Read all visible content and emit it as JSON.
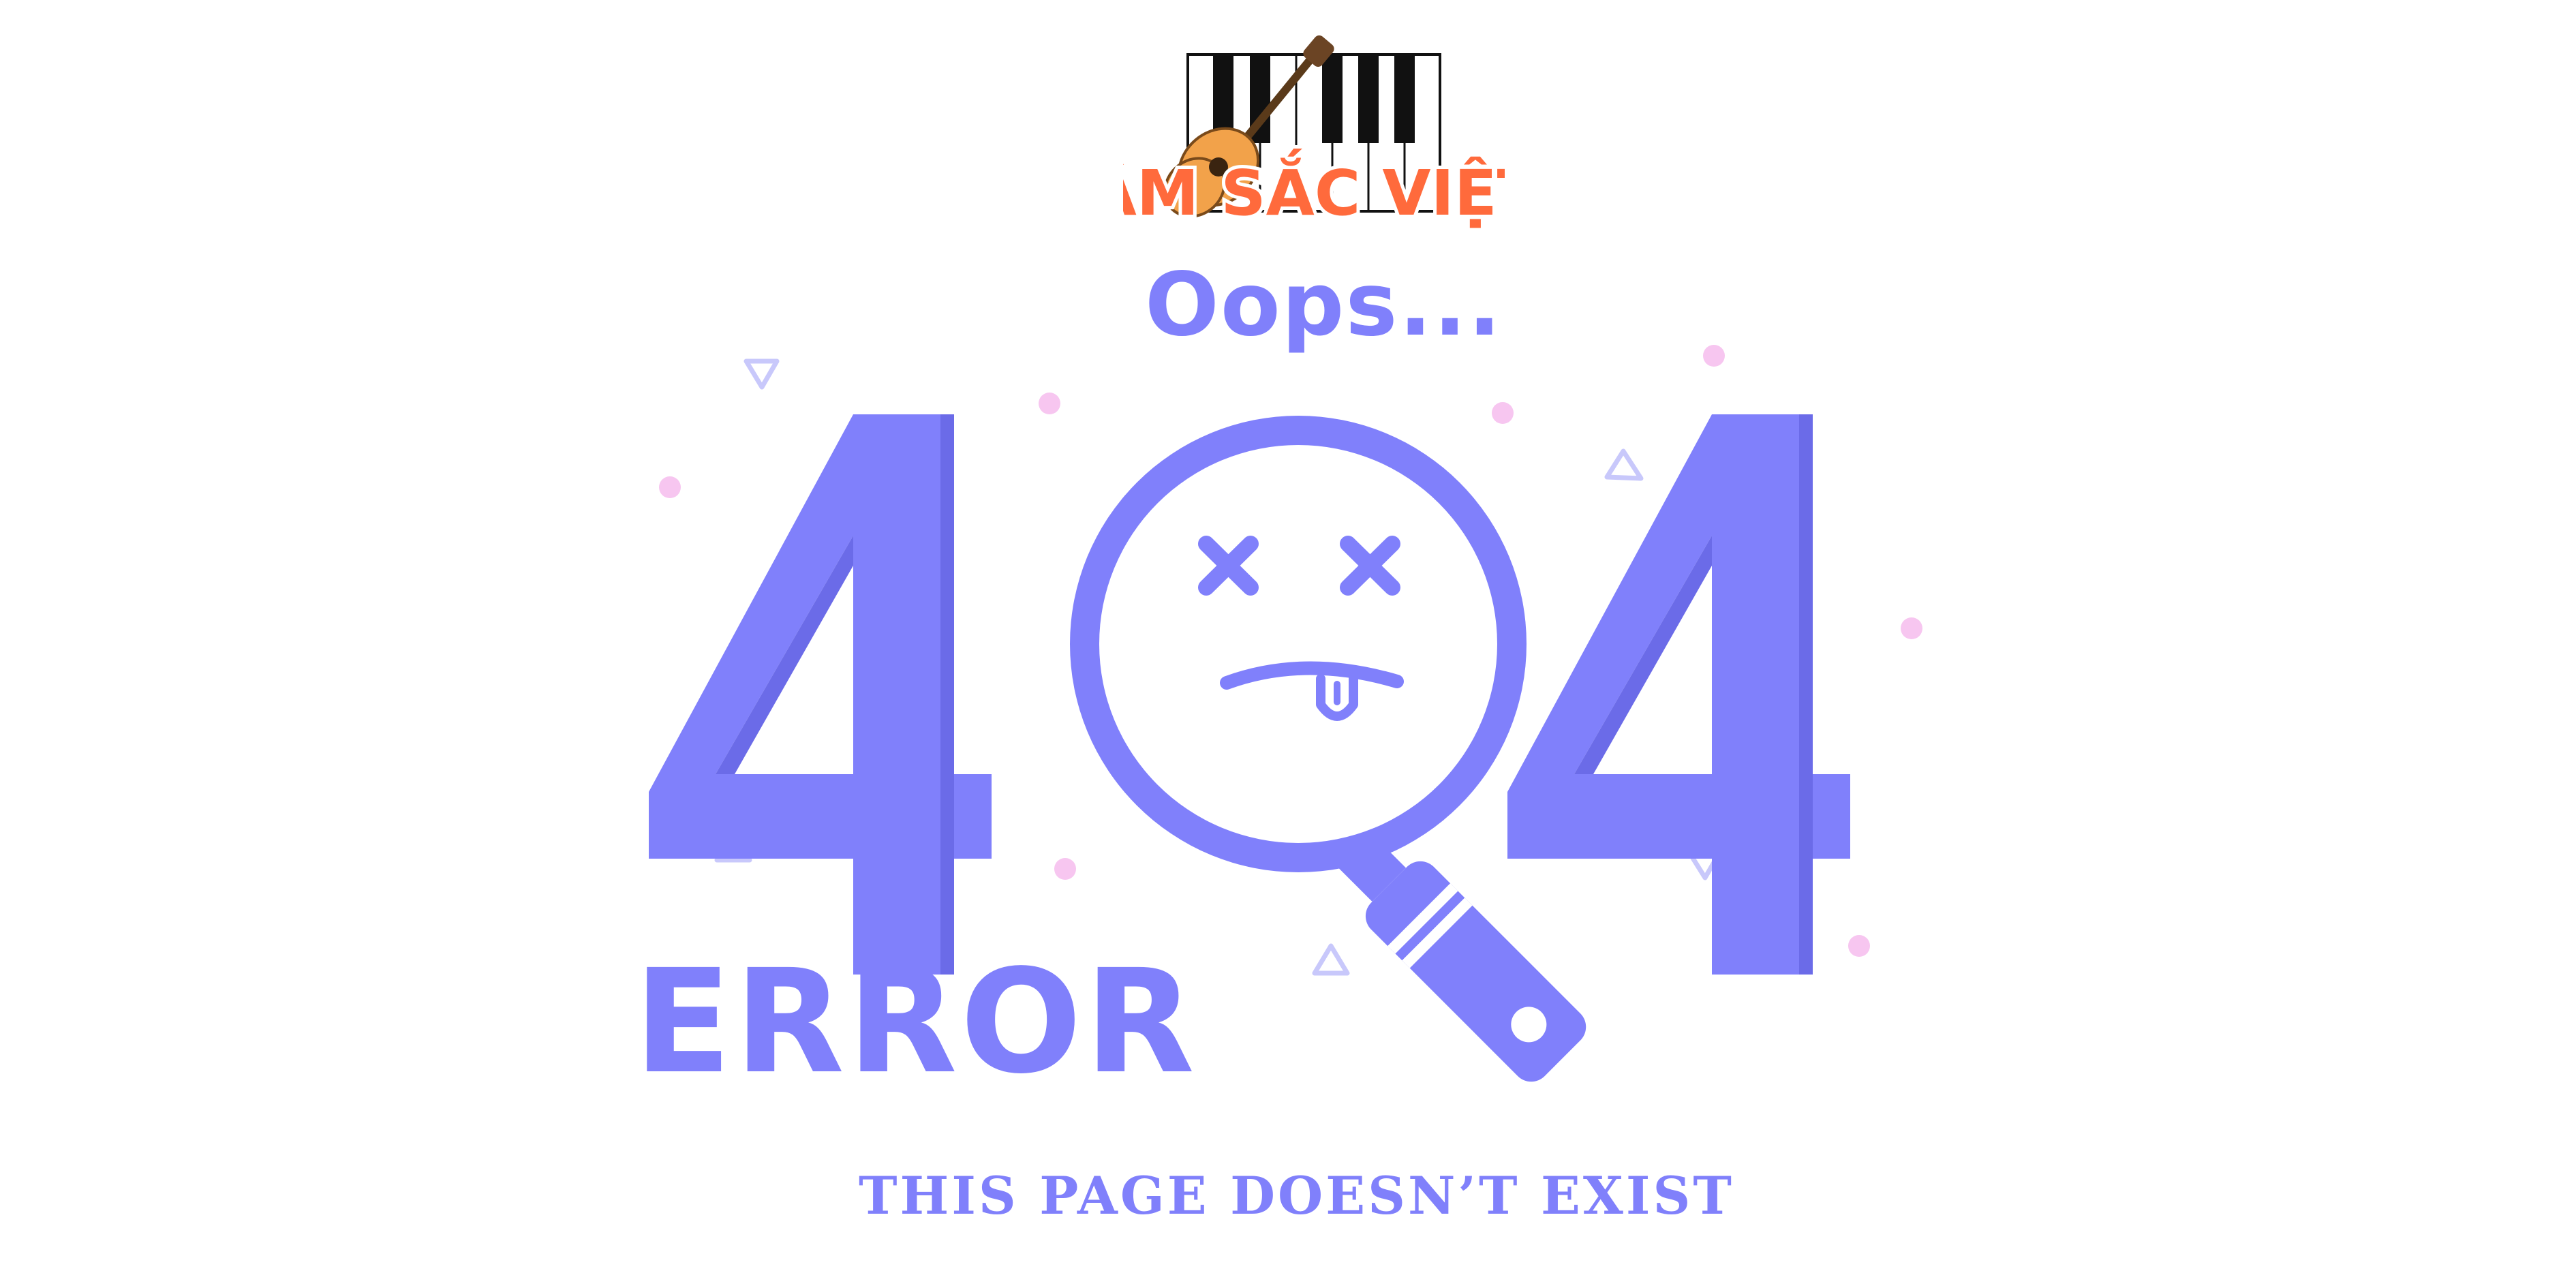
{
  "brand": {
    "logo_text": "ÂM SẮC VIỆT",
    "logo_colors": {
      "text_fill": "#ff6a3c",
      "text_outline": "#ffffff",
      "piano_black": "#111111",
      "guitar_body": "#f2a24a"
    }
  },
  "error_page": {
    "oops": "Oops...",
    "code": "404",
    "label": "ERROR",
    "message": "THIS PAGE DOESN’T EXIST"
  },
  "theme": {
    "accent": "#8080fb",
    "accent_dark": "#6b6be8",
    "dot_color": "#f7c6f0",
    "triangle_color": "#c8c8fb",
    "background": "#ffffff"
  },
  "icons": {
    "logo": "guitar-piano-logo",
    "magnifier": "magnifying-glass-sad-face-icon"
  }
}
